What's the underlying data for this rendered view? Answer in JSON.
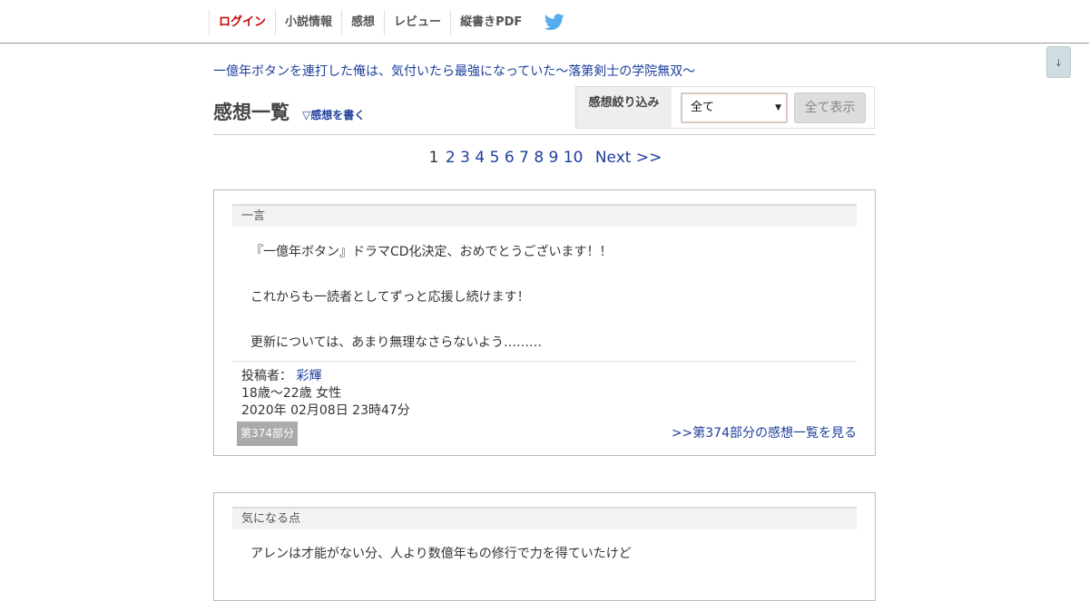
{
  "header": {
    "nav": [
      "ログイン",
      "小説情報",
      "感想",
      "レビュー",
      "縦書きPDF"
    ],
    "twitter_icon": "twitter-bird-icon",
    "twitter_color": "#55acee"
  },
  "scroll_button": "↓",
  "novel_title": "一億年ボタンを連打した俺は、気付いたら最強になっていた～落第剣士の学院無双～",
  "page_title": "感想一覧",
  "write_link": "▽感想を書く",
  "filter": {
    "label": "感想絞り込み",
    "selected": "全て",
    "button": "全て表示"
  },
  "pager": {
    "current": "1",
    "pages": [
      "2",
      "3",
      "4",
      "5",
      "6",
      "7",
      "8",
      "9",
      "10"
    ],
    "next": "Next >>"
  },
  "comments": [
    {
      "heading": "一言",
      "lines": [
        "『一億年ボタン』ドラマCD化決定、おめでとうございます！！",
        "これからも一読者としてずっと応援し続けます！",
        "更新については、あまり無理なさらないよう………"
      ],
      "poster_label": "投稿者：",
      "poster": "彩輝",
      "demographic": "18歳～22歳 女性",
      "date": "2020年 02月08日 23時47分",
      "part": "第374部分",
      "part_link": ">>第374部分の感想一覧を見る"
    },
    {
      "heading": "気になる点",
      "lines": [
        "アレンは才能がない分、人より数億年もの修行で力を得ていたけど"
      ]
    }
  ],
  "colors": {
    "link": "#1d3e9c",
    "login": "#cc0000",
    "badge": "#aaaaaa"
  }
}
